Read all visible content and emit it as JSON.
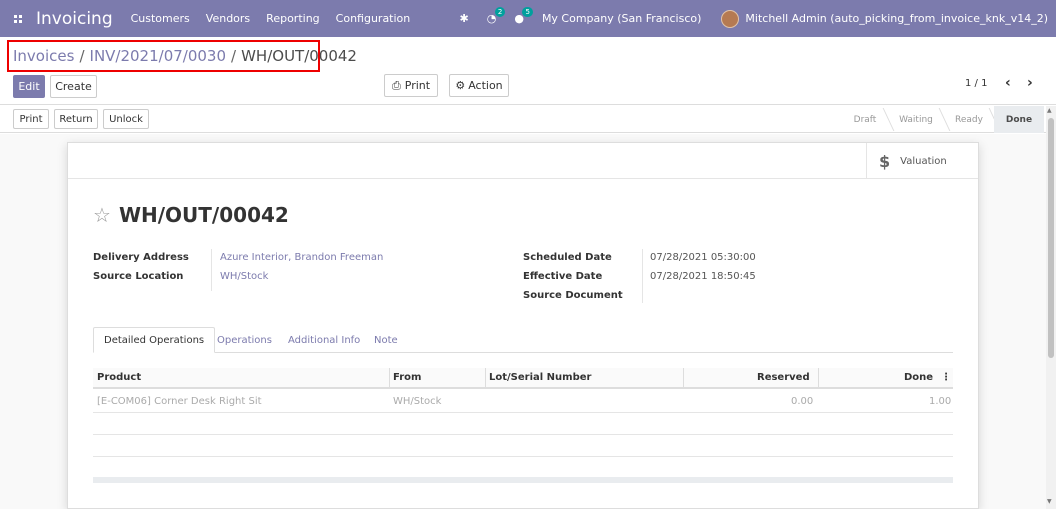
{
  "navbar": {
    "app_title": "Invoicing",
    "menu": [
      "Customers",
      "Vendors",
      "Reporting",
      "Configuration"
    ],
    "activity_badge": "2",
    "messages_badge": "5",
    "company": "My Company (San Francisco)",
    "user": "Mitchell Admin (auto_picking_from_invoice_knk_v14_2)"
  },
  "breadcrumb": {
    "items": [
      "Invoices",
      "INV/2021/07/0030"
    ],
    "current": "WH/OUT/00042",
    "separator": "/"
  },
  "control_panel": {
    "edit_label": "Edit",
    "create_label": "Create",
    "print_label": "Print",
    "action_label": "Action",
    "pager": "1 / 1"
  },
  "statusbar": {
    "buttons": [
      "Print",
      "Return",
      "Unlock"
    ],
    "stages": [
      "Draft",
      "Waiting",
      "Ready",
      "Done"
    ],
    "current_stage": "Done"
  },
  "sheet": {
    "valuation_label": "Valuation",
    "record_name": "WH/OUT/00042",
    "left_fields": [
      {
        "label": "Delivery Address",
        "value": "Azure Interior, Brandon Freeman"
      },
      {
        "label": "Source Location",
        "value": "WH/Stock"
      }
    ],
    "right_fields": [
      {
        "label": "Scheduled Date",
        "value": "07/28/2021 05:30:00"
      },
      {
        "label": "Effective Date",
        "value": "07/28/2021 18:50:45"
      },
      {
        "label": "Source Document",
        "value": ""
      }
    ],
    "tabs": [
      "Detailed Operations",
      "Operations",
      "Additional Info",
      "Note"
    ],
    "table": {
      "columns": [
        "Product",
        "From",
        "Lot/Serial Number",
        "Reserved",
        "Done"
      ],
      "rows": [
        {
          "product": "[E-COM06] Corner Desk Right Sit",
          "from": "WH/Stock",
          "lot": "",
          "reserved": "0.00",
          "done": "1.00"
        }
      ]
    }
  },
  "colors": {
    "brand": "#7c7bad",
    "highlight_border": "#ee0000"
  }
}
